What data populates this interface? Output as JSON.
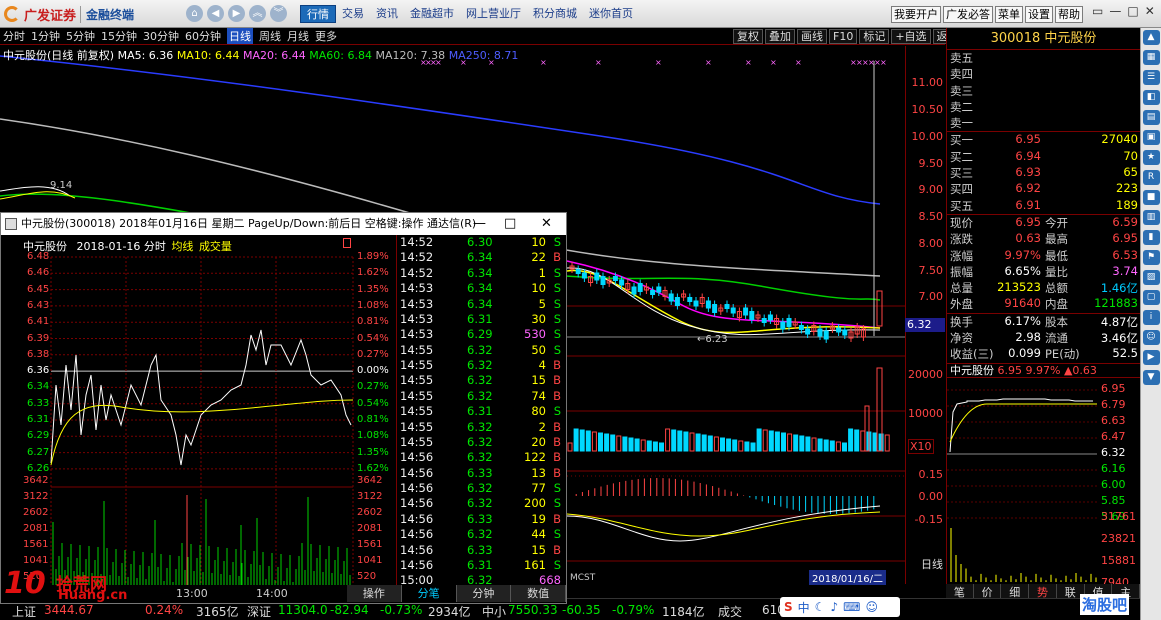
{
  "topbar": {
    "logo_brand": "广发证券",
    "logo_product": "金融终端",
    "main_menu": [
      "行情",
      "交易",
      "资讯",
      "金融超市",
      "网上营业厅",
      "积分商城",
      "迷你首页"
    ],
    "right_menu": [
      "我要开户",
      "广发必答",
      "菜单",
      "设置",
      "帮助"
    ]
  },
  "periods": [
    "分时",
    "1分钟",
    "5分钟",
    "15分钟",
    "30分钟",
    "60分钟",
    "日线",
    "周线",
    "月线",
    "更多"
  ],
  "chart_tools": [
    "复权",
    "叠加",
    "画线",
    "F10",
    "标记",
    "+自选",
    "返回"
  ],
  "ma_legend": {
    "name": "中元股份(日线 前复权)",
    "ma5": "MA5: 6.36",
    "ma10": "MA10: 6.44",
    "ma20": "MA20: 6.44",
    "ma60": "MA60: 6.84",
    "ma120": "MA120: 7.38",
    "ma250": "MA250: 8.71"
  },
  "kline_colors": {
    "ma5": "#ffffff",
    "ma10": "#ffff00",
    "ma20": "#ff00ff",
    "ma60": "#00d000",
    "ma120": "#bbbbbb",
    "ma250": "#2a3cff"
  },
  "y_axis_labels": [
    "11.00",
    "10.50",
    "10.00",
    "9.50",
    "9.00",
    "8.50",
    "8.00",
    "7.50",
    "7.00"
  ],
  "price_marker": "6.32",
  "low_marker": "←6.23",
  "high_marker": "9.14",
  "volume_axis": [
    "20000",
    "10000"
  ],
  "volume_unit": "X10",
  "macd_axis": [
    "0.15",
    "0.00",
    "-0.15"
  ],
  "macd_label": "MCST",
  "x_label": "12",
  "selected_date": "2018/01/16/二",
  "day_label": "日线",
  "quote": {
    "title": "300018 中元股份",
    "sell": [
      {
        "label": "卖五"
      },
      {
        "label": "卖四"
      },
      {
        "label": "卖三"
      },
      {
        "label": "卖二"
      },
      {
        "label": "卖一"
      }
    ],
    "buy": [
      {
        "label": "买一",
        "price": "6.95",
        "vol": "27040"
      },
      {
        "label": "买二",
        "price": "6.94",
        "vol": "70"
      },
      {
        "label": "买三",
        "price": "6.93",
        "vol": "65"
      },
      {
        "label": "买四",
        "price": "6.92",
        "vol": "223"
      },
      {
        "label": "买五",
        "price": "6.91",
        "vol": "189"
      }
    ],
    "stats": [
      {
        "l": "现价",
        "v": "6.95",
        "vc": "red",
        "l2": "今开",
        "v2": "6.59",
        "v2c": "red"
      },
      {
        "l": "涨跌",
        "v": "0.63",
        "vc": "red",
        "l2": "最高",
        "v2": "6.95",
        "v2c": "red"
      },
      {
        "l": "涨幅",
        "v": "9.97%",
        "vc": "red",
        "l2": "最低",
        "v2": "6.53",
        "v2c": "red"
      },
      {
        "l": "振幅",
        "v": "6.65%",
        "vc": "wht",
        "l2": "量比",
        "v2": "3.74",
        "v2c": "mag"
      },
      {
        "l": "总量",
        "v": "213523",
        "vc": "yel",
        "l2": "总额",
        "v2": "1.46亿",
        "v2c": "cy"
      },
      {
        "l": "外盘",
        "v": "91640",
        "vc": "red",
        "l2": "内盘",
        "v2": "121883",
        "v2c": "grn"
      }
    ],
    "stats2": [
      {
        "l": "换手",
        "v": "6.17%",
        "vc": "wht",
        "l2": "股本",
        "v2": "4.87亿",
        "v2c": "wht"
      },
      {
        "l": "净资",
        "v": "2.98",
        "vc": "wht",
        "l2": "流通",
        "v2": "3.46亿",
        "v2c": "wht"
      },
      {
        "l": "收益(三)",
        "v": "0.099",
        "vc": "wht",
        "l2": "PE(动)",
        "v2": "52.5",
        "v2c": "wht"
      }
    ],
    "mini_header": {
      "name": "中元股份",
      "price": "6.95",
      "pct": "9.97%",
      "chg": "▲0.63"
    },
    "mini_axis": [
      "6.95",
      "6.79",
      "6.63",
      "6.47",
      "6.32",
      "6.16",
      "6.00",
      "5.85",
      "5.69"
    ],
    "mini_vol_axis": [
      "31761",
      "23821",
      "15881",
      "7940"
    ],
    "tabs": [
      "笔",
      "价",
      "细",
      "势",
      "联",
      "值",
      "主"
    ]
  },
  "popup": {
    "title": "中元股份(300018) 2018年01月16日 星期二 PageUp/Down:前后日 空格键:操作 通达信(R)",
    "subtitle_name": "中元股份",
    "subtitle_date": "2018-01-16 分时",
    "subtitle_avg": "均线",
    "subtitle_vol": "成交量",
    "left_axis": [
      "6.48",
      "6.46",
      "6.45",
      "6.43",
      "6.41",
      "6.39",
      "6.38",
      "6.36",
      "6.34",
      "6.33",
      "6.31",
      "6.29",
      "6.27",
      "6.26"
    ],
    "right_axis": [
      "1.89%",
      "1.62%",
      "1.35%",
      "1.08%",
      "0.81%",
      "0.54%",
      "0.27%",
      "0.00%",
      "0.27%",
      "0.54%",
      "0.81%",
      "1.08%",
      "1.35%",
      "1.62%"
    ],
    "vol_axis": [
      "3642",
      "3122",
      "2602",
      "2081",
      "1561",
      "1041",
      "520"
    ],
    "time_axis": [
      "13:00",
      "14:00"
    ],
    "ticks": [
      {
        "t": "14:52",
        "p": "6.30",
        "q": "10",
        "s": "S"
      },
      {
        "t": "14:52",
        "p": "6.34",
        "q": "22",
        "s": "B"
      },
      {
        "t": "14:52",
        "p": "6.34",
        "q": "1",
        "s": "S"
      },
      {
        "t": "14:53",
        "p": "6.34",
        "q": "10",
        "s": "S"
      },
      {
        "t": "14:53",
        "p": "6.34",
        "q": "5",
        "s": "S"
      },
      {
        "t": "14:53",
        "p": "6.31",
        "q": "30",
        "s": "S"
      },
      {
        "t": "14:53",
        "p": "6.29",
        "q": "530",
        "s": "S"
      },
      {
        "t": "14:55",
        "p": "6.32",
        "q": "50",
        "s": "S"
      },
      {
        "t": "14:55",
        "p": "6.32",
        "q": "4",
        "s": "B"
      },
      {
        "t": "14:55",
        "p": "6.32",
        "q": "15",
        "s": "B"
      },
      {
        "t": "14:55",
        "p": "6.32",
        "q": "74",
        "s": "B"
      },
      {
        "t": "14:55",
        "p": "6.31",
        "q": "80",
        "s": "S"
      },
      {
        "t": "14:55",
        "p": "6.32",
        "q": "2",
        "s": "B"
      },
      {
        "t": "14:55",
        "p": "6.32",
        "q": "20",
        "s": "B"
      },
      {
        "t": "14:56",
        "p": "6.32",
        "q": "122",
        "s": "B"
      },
      {
        "t": "14:56",
        "p": "6.33",
        "q": "13",
        "s": "B"
      },
      {
        "t": "14:56",
        "p": "6.32",
        "q": "77",
        "s": "S"
      },
      {
        "t": "14:56",
        "p": "6.32",
        "q": "200",
        "s": "S"
      },
      {
        "t": "14:56",
        "p": "6.33",
        "q": "19",
        "s": "B"
      },
      {
        "t": "14:56",
        "p": "6.32",
        "q": "44",
        "s": "S"
      },
      {
        "t": "14:56",
        "p": "6.33",
        "q": "15",
        "s": "B"
      },
      {
        "t": "14:56",
        "p": "6.31",
        "q": "161",
        "s": "S"
      },
      {
        "t": "15:00",
        "p": "6.32",
        "q": "668",
        "s": ""
      }
    ],
    "tabs": [
      "操作",
      "分笔",
      "分钟",
      "数值"
    ]
  },
  "statusbar": {
    "sh_label": "上证",
    "sh_value": "3444.67",
    "sh_pct": "0.24%",
    "sh_amount": "3165亿",
    "sz_label": "深证",
    "sz_value": "11304.0",
    "sz_chg": "-82.94",
    "sz_pct": "-0.73%",
    "sz_amount": "2934亿",
    "zx_label": "中小",
    "zx_value": "7550.33",
    "zx_chg": "-60.35",
    "zx_pct": "-0.79%",
    "zx_amount": "1184亿",
    "deal_label": "成交",
    "deal_value": "610"
  },
  "watermark": {
    "ten": "10",
    "site": "拾荒网",
    "url": "Huang.cn",
    "right": "淘股吧"
  },
  "ime": {
    "s": "S",
    "label": "中"
  }
}
